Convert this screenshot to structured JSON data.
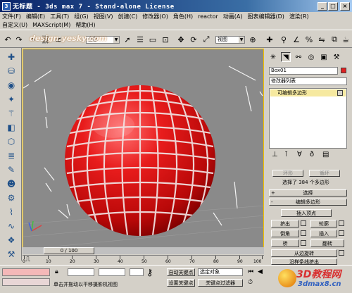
{
  "window": {
    "title": "无标题 - 3ds max 7 - Stand-alone License",
    "minimize_glyph": "_",
    "maximize_glyph": "□",
    "close_glyph": "×"
  },
  "menu": {
    "row1": [
      "文件(F)",
      "编辑(E)",
      "工具(T)",
      "组(G)",
      "视图(V)",
      "创建(C)",
      "修改器(O)",
      "角色(H)",
      "reactor",
      "动画(A)",
      "图表编辑器(D)",
      "渲染(R)"
    ],
    "row2": [
      "自定义(U)",
      "MAXScript(M)",
      "帮助(H)"
    ]
  },
  "toolbar": {
    "selection_filter": "全部",
    "reference_coord": "视图"
  },
  "watermark": "design.yesky.com",
  "viewport": {
    "label": "",
    "sphere_color": "#e01818",
    "grid_line_color": "#e8e8e8",
    "background": "#8a8a8a",
    "border_color": "#f2c100"
  },
  "timeline": {
    "frame_indicator": "0 / 100",
    "ticks": [
      "0",
      "10",
      "20",
      "30",
      "40",
      "50",
      "60",
      "70",
      "80",
      "90",
      "100"
    ]
  },
  "command_panel": {
    "object_name": "Box01",
    "modifier_list": "修改器列表",
    "stack_item": "可编辑多边形",
    "btn_ring": "环形",
    "btn_loop": "循环",
    "selection_info": "选择了 384 个多边形",
    "rollout_selection": "选择",
    "rollout_edit_poly": "编辑多边形",
    "btn_insert_vertex": "插入顶点",
    "btn_extrude": "挤出",
    "btn_outline": "轮廓",
    "btn_bevel": "倒角",
    "btn_inset": "插入",
    "btn_bridge": "桥",
    "btn_flip": "翻转",
    "btn_hinge_from_edge": "从边旋转",
    "btn_extrude_along_spline": "沿样条线挤出"
  },
  "status": {
    "prompt": "单击并拖动以平移摄影机视图",
    "auto_key": "自动关键点",
    "set_key": "设置关键点",
    "key_filter_value": "选定对象",
    "key_filters": "关键点过滤器"
  },
  "logo": {
    "line1": "3D教程网",
    "line2": "3dmax8.cn"
  }
}
